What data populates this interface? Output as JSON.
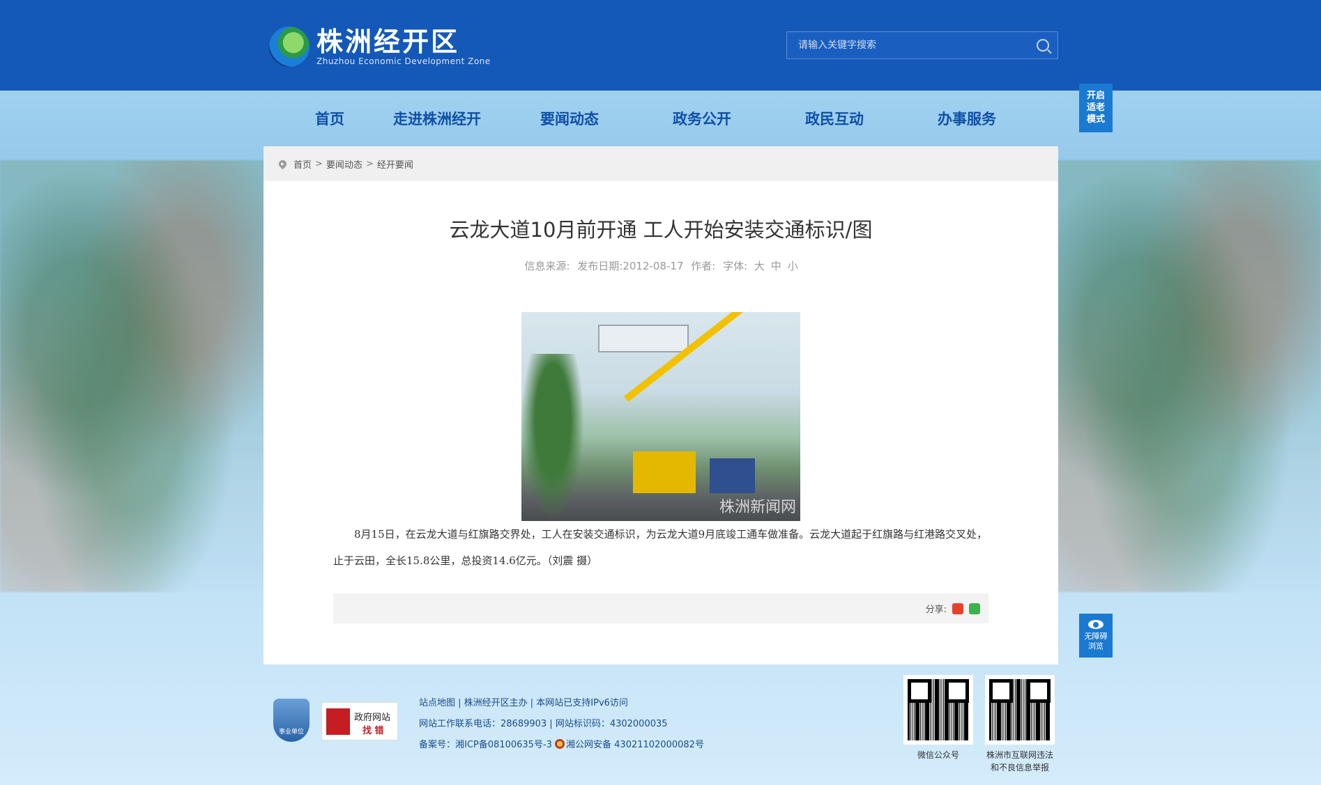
{
  "header": {
    "logo_cn": "株洲经开区",
    "logo_en": "Zhuzhou Economic Development Zone",
    "search_placeholder": "请输入关键字搜索"
  },
  "nav": {
    "items": [
      "首页",
      "走进株洲经开",
      "要闻动态",
      "政务公开",
      "政民互动",
      "办事服务"
    ]
  },
  "side_buttons": {
    "elder_mode": [
      "开启",
      "适老",
      "模式"
    ],
    "accessibility": [
      "无障碍",
      "浏览"
    ]
  },
  "breadcrumb": {
    "items": [
      "首页",
      "要闻动态",
      "经开要闻"
    ],
    "separator": ">"
  },
  "article": {
    "title": "云龙大道10月前开通 工人开始安装交通标识/图",
    "meta_source": "信息来源:",
    "meta_date": "发布日期:2012-08-17",
    "meta_author": "作者:",
    "meta_font": "字体:",
    "font_sizes": [
      "大",
      "中",
      "小"
    ],
    "photo_watermark": "株洲新闻网",
    "body": "8月15日，在云龙大道与红旗路交界处，工人在安装交通标识，为云龙大道9月底竣工通车做准备。云龙大道起于红旗路与红港路交叉处，止于云田，全长15.8公里，总投资14.6亿元。（刘震 摄）",
    "share_label": "分享:"
  },
  "footer": {
    "badge_label": "事业单位",
    "gov_error_line1": "政府网站",
    "gov_error_line2": "找 错",
    "line1": "站点地图 | 株洲经开区主办 | 本网站已支持IPv6访问",
    "line2": "网站工作联系电话：28689903 | 网站标识码：4302000035",
    "line3_icp": "备案号：湘ICP备08100635号-3",
    "line3_police": "湘公网安备 43021102000082号",
    "qr_wechat_label": "微信公众号",
    "qr_report_label_1": "株洲市互联网违法",
    "qr_report_label_2": "和不良信息举报"
  },
  "colors": {
    "header_blue": "#1458b8",
    "nav_text": "#0f4fa8",
    "side_button": "#1a7ad2"
  }
}
